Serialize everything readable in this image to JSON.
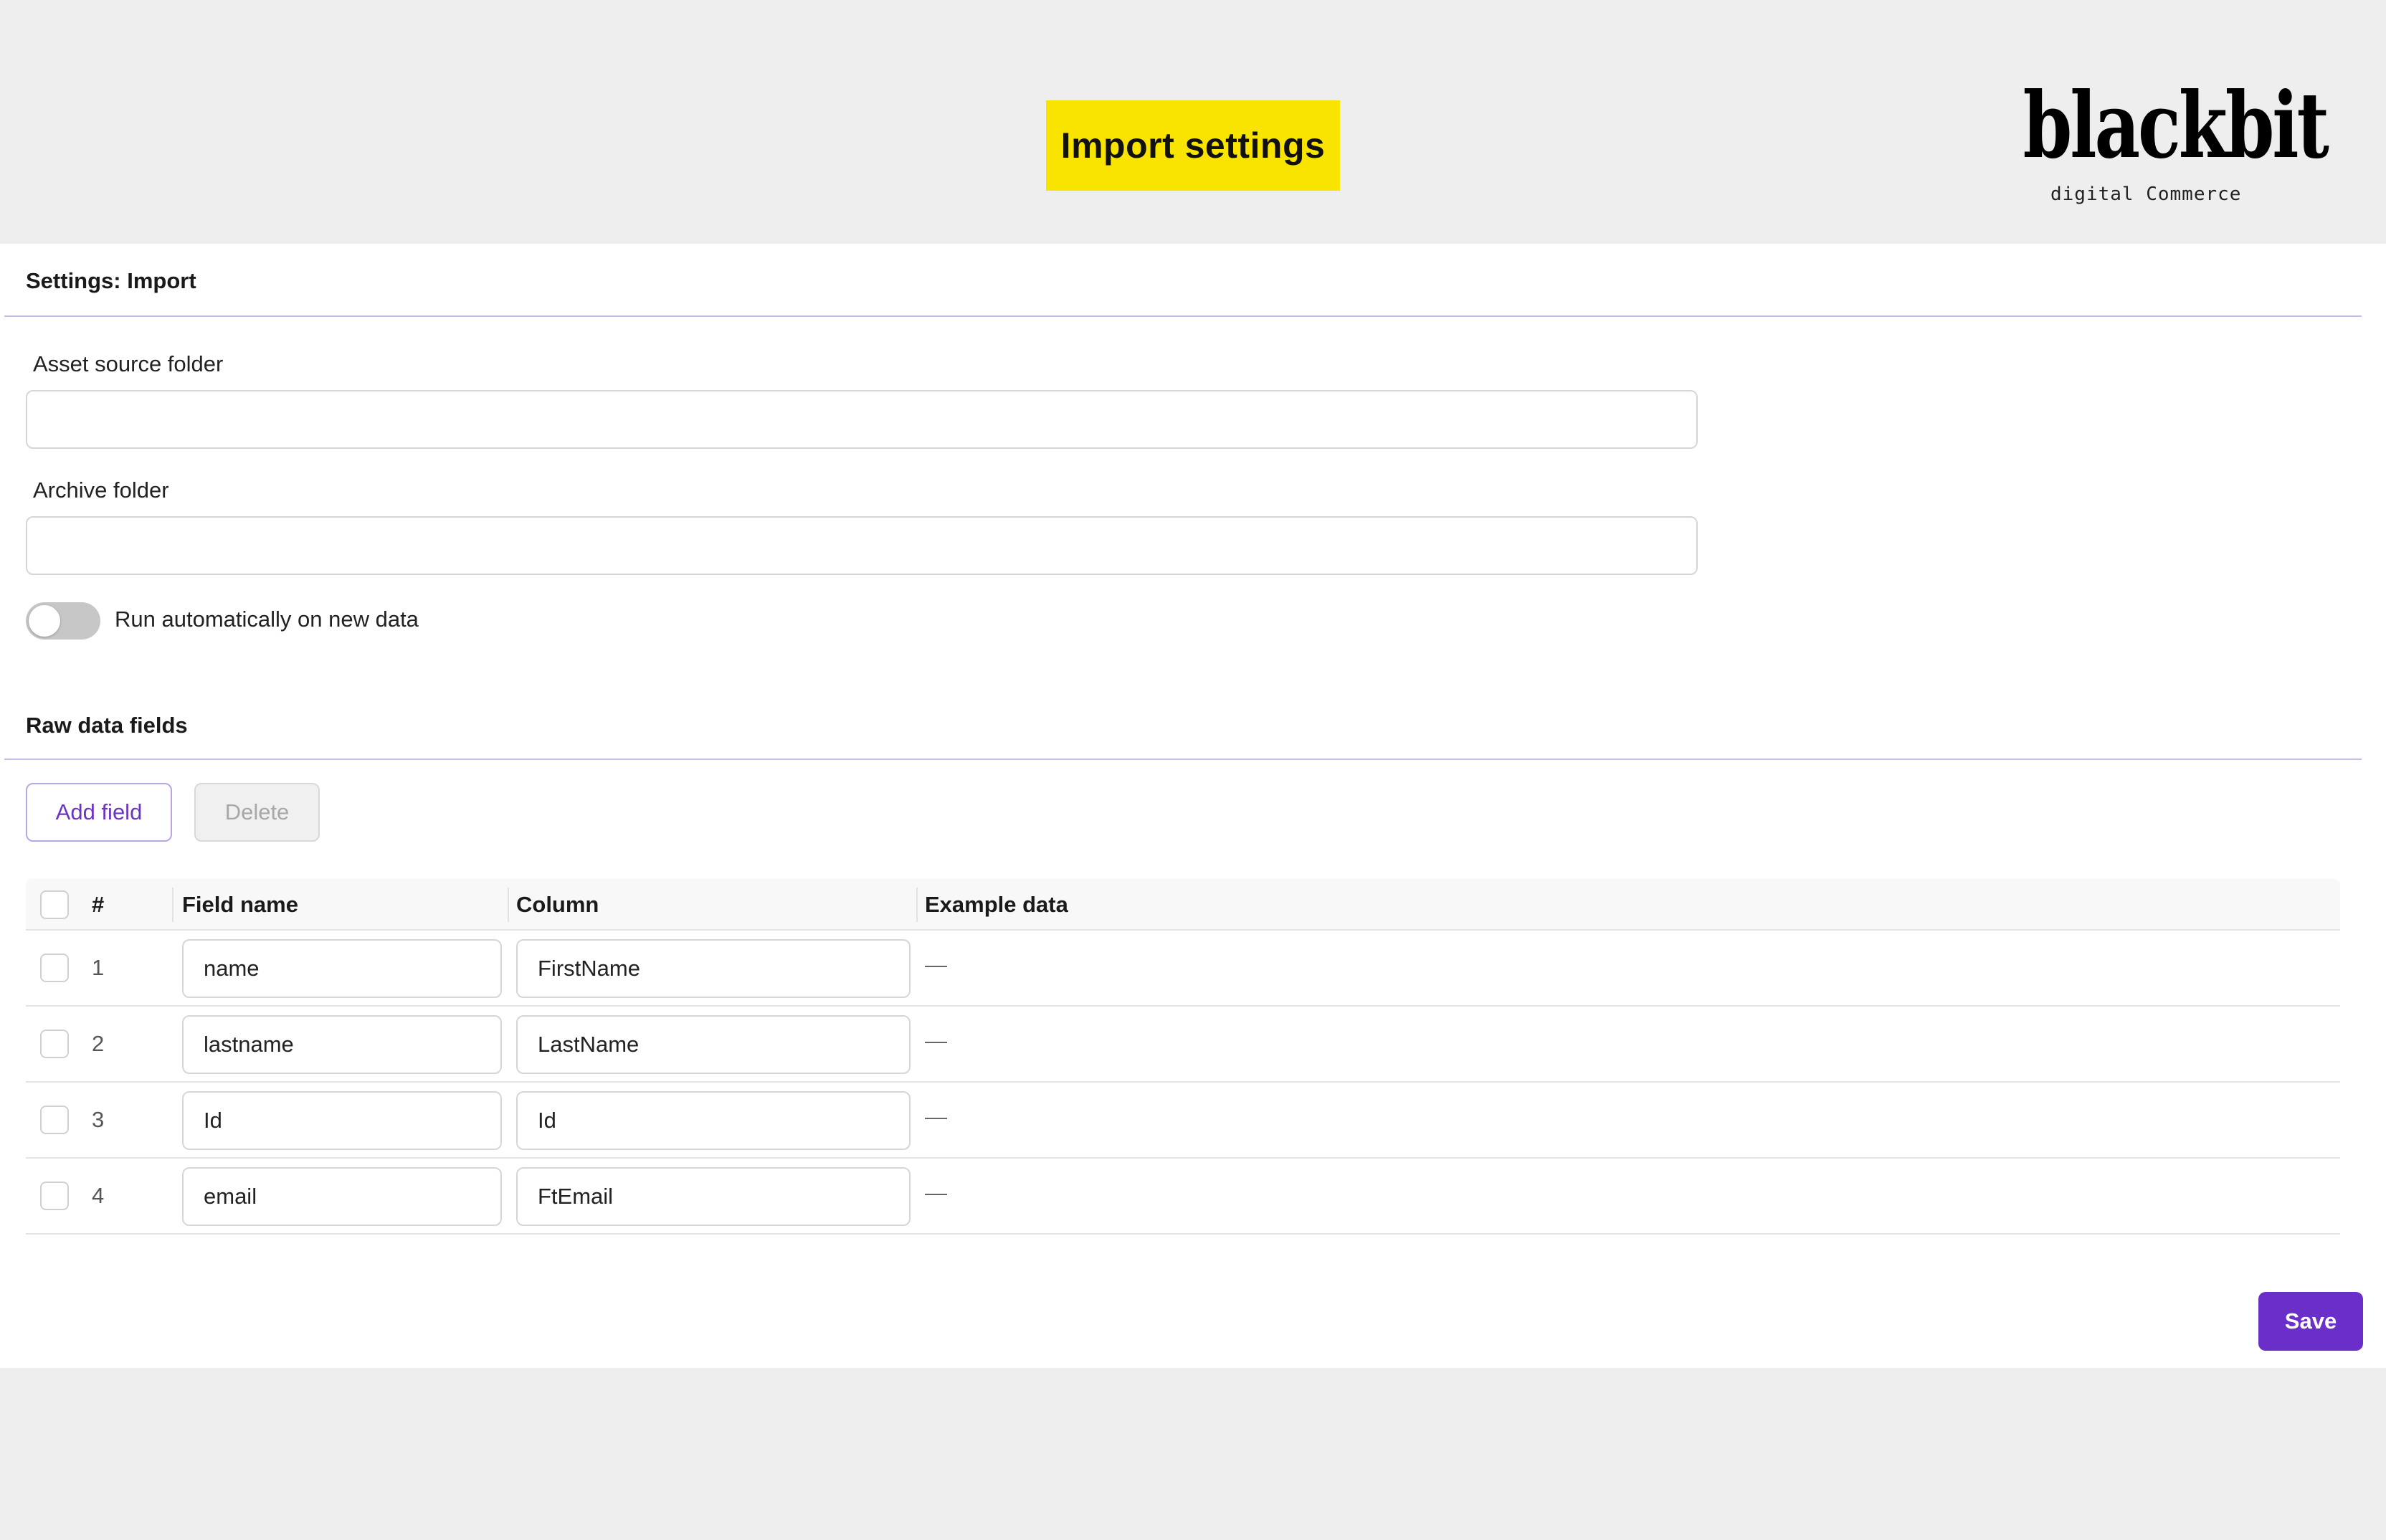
{
  "header": {
    "title": "Import settings",
    "logo_text": "blackbit",
    "logo_subtitle": "digital Commerce"
  },
  "settings": {
    "section_title": "Settings: Import",
    "asset_source_label": "Asset source folder",
    "asset_source_value": "",
    "archive_label": "Archive folder",
    "archive_value": "",
    "auto_run_label": "Run automatically on new data",
    "auto_run_enabled": false
  },
  "raw_fields": {
    "section_title": "Raw data fields",
    "add_label": "Add field",
    "delete_label": "Delete",
    "columns": [
      "#",
      "Field name",
      "Column",
      "Example data"
    ],
    "rows": [
      {
        "num": "1",
        "field_name": "name",
        "column": "FirstName",
        "example": "—"
      },
      {
        "num": "2",
        "field_name": "lastname",
        "column": "LastName",
        "example": "—"
      },
      {
        "num": "3",
        "field_name": "Id",
        "column": "Id",
        "example": "—"
      },
      {
        "num": "4",
        "field_name": "email",
        "column": "FtEmail",
        "example": "—"
      }
    ]
  },
  "footer": {
    "save_label": "Save"
  },
  "colors": {
    "title_badge": "#f9e400",
    "accent": "#6a2fc9",
    "rule": "#c9bbe8"
  }
}
